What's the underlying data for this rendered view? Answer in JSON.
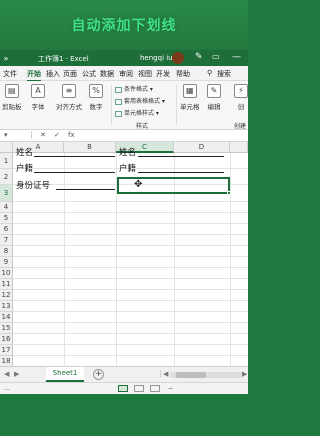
{
  "banner": {
    "title": "自动添加下划线"
  },
  "titlebar": {
    "left_icon": "»",
    "workbook": "工作簿1 · Excel",
    "user": "hengqi iu",
    "pen_icon": "✎",
    "window_icon": "▭",
    "minimize_icon": "—"
  },
  "menu": {
    "items": [
      "文件",
      "开始",
      "插入",
      "页面",
      "公式",
      "数据",
      "审阅",
      "视图",
      "开发",
      "帮助",
      "搜索"
    ],
    "search_icon": "⚲"
  },
  "ribbon": {
    "clipboard": "剪贴板",
    "font": "字体",
    "align": "对齐方式",
    "number": "数字",
    "cond_format": "条件格式",
    "table_format": "套用表格格式",
    "cell_styles": "单元格样式",
    "styles_group": "样式",
    "cells": "单元格",
    "edit": "编辑",
    "create": "创",
    "create_group": "创建"
  },
  "sheet": {
    "columns": [
      "A",
      "B",
      "C",
      "D"
    ],
    "rows": [
      "1",
      "2",
      "3",
      "4",
      "5",
      "6",
      "7",
      "8",
      "9",
      "10",
      "11",
      "12",
      "13",
      "14",
      "15",
      "16",
      "17",
      "18",
      "19"
    ],
    "cells": {
      "A1": "姓名",
      "A2": "户籍",
      "A3": "身份证号",
      "C1": "姓名",
      "C2": "户籍"
    },
    "selected_column": "C",
    "selected_row": "3"
  },
  "sheetbar": {
    "tab": "Sheet1",
    "add_label": "+",
    "prev": "◀",
    "next": "▶",
    "scroll_prev": "◀",
    "scroll_next": "▶"
  },
  "status": {
    "zoom_ellipsis": "…"
  }
}
